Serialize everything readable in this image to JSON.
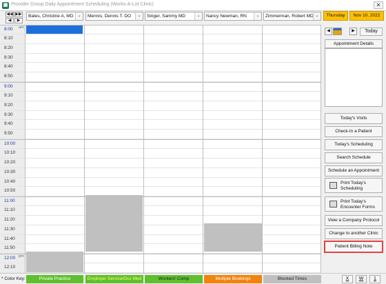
{
  "window": {
    "title": "Provider Group Daily Appointment Scheduling (Works-A-Lot Clinic)",
    "close_label": "✕"
  },
  "nav": {
    "first": "◀◀",
    "prev": "◀",
    "last": "▶▶",
    "next": "▶"
  },
  "providers": [
    {
      "name": "Bates, Christine A, MD"
    },
    {
      "name": "Mennis, Dennis T. DO"
    },
    {
      "name": "Singer, Sammy  MD"
    },
    {
      "name": "Nancy Newman, RN"
    },
    {
      "name": "Zimmerman, Robert  MD"
    }
  ],
  "dropdown_glyph": "⌄",
  "date": {
    "day": "Thursday",
    "date": "Nov 10, 2022"
  },
  "ampm": {
    "am": "am",
    "pm": "pm"
  },
  "times": [
    "8:00",
    "8:10",
    "8:20",
    "8:30",
    "8:40",
    "8:50",
    "9:00",
    "9:10",
    "9:20",
    "9:30",
    "9:40",
    "9:50",
    "10:00",
    "10:10",
    "10:20",
    "10:30",
    "10:40",
    "10:50",
    "11:00",
    "11:10",
    "11:20",
    "11:30",
    "11:40",
    "11:50",
    "12:00",
    "12:10"
  ],
  "panel": {
    "today_label": "Today",
    "appointment_details": "Appointment Details",
    "buttons": {
      "todays_visits": "Today's Visits",
      "check_in": "Check-In a Patient",
      "todays_scheduling": "Today's Scheduling",
      "search_schedule": "Search Schedule",
      "schedule_appointment": "Schedule an Appointment",
      "print_scheduling_1": "Print Today's",
      "print_scheduling_2": "Scheduling",
      "print_forms_1": "Print Today's",
      "print_forms_2": "Encounter Forms",
      "company_protocol": "View a Company Protocol",
      "change_clinic": "Change to another Clinic",
      "billing_note": "Patient Billing Note"
    }
  },
  "color_key": {
    "label": "* Color Key:",
    "items": [
      {
        "label": "Private Practice",
        "color": "#5fbf2f",
        "text_color": "#ffffff"
      },
      {
        "label": "Employer Service/Occ Med",
        "color": "#5fbf2f",
        "text_color": "#ffff66"
      },
      {
        "label": "Workers' Comp",
        "color": "#5fbf2f",
        "text_color": "#222222"
      },
      {
        "label": "Multiple Bookings",
        "color": "#f0840c",
        "text_color": "#ffffff"
      },
      {
        "label": "Blocked Times",
        "color": "#c0c0c0",
        "text_color": "#222222"
      }
    ]
  },
  "footer_buttons": {
    "x": "X",
    "w": "W",
    "one": "1"
  },
  "colors": {
    "selected": "#1e6fd9",
    "blocked": "#c0c0c0",
    "highlight": "#e04040",
    "date_bg": "#ffc000"
  }
}
